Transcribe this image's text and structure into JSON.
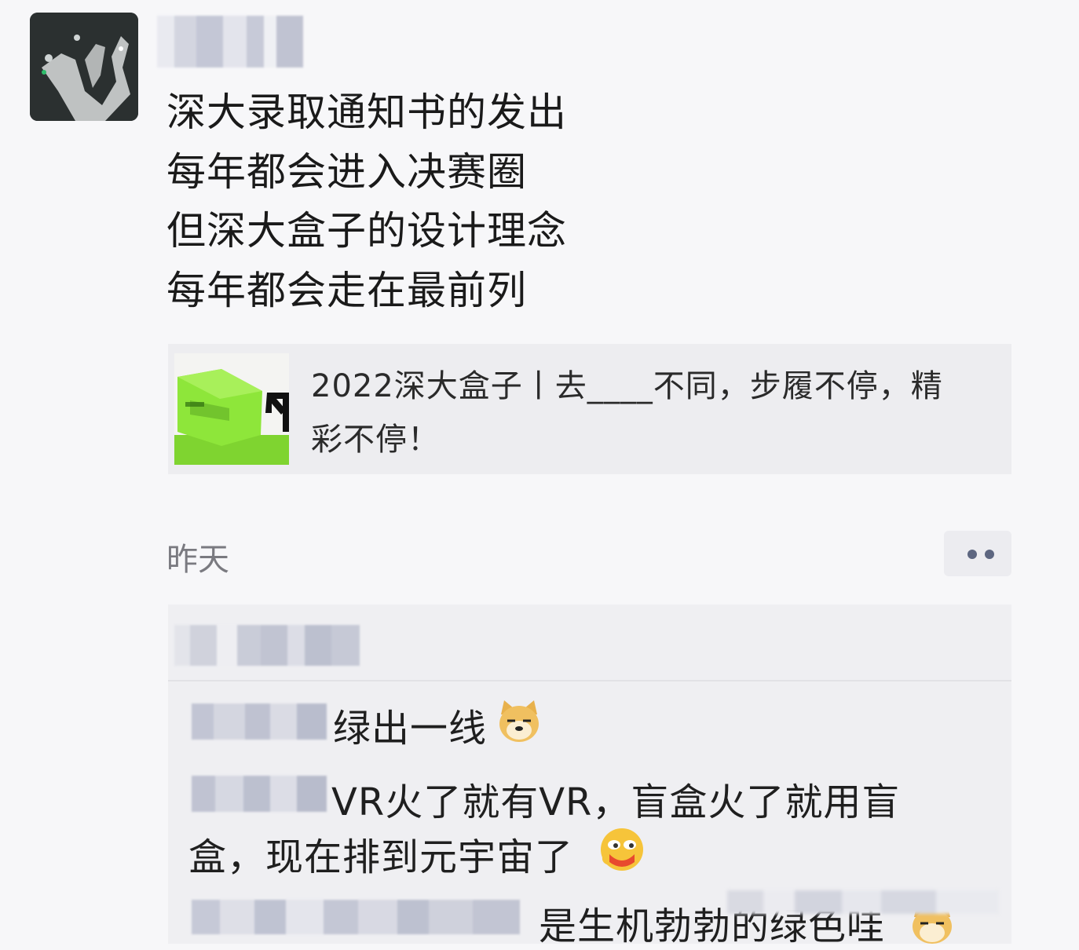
{
  "post": {
    "lines": [
      "深大录取通知书的发出",
      "每年都会进入决赛圈",
      "但深大盒子的设计理念",
      "每年都会走在最前列"
    ]
  },
  "link": {
    "title_line1": "2022深大盒子丨去____不同，步履不停，精",
    "title_line2": "彩不停！"
  },
  "time": "昨天",
  "comments": [
    {
      "text": "绿出一线",
      "emoji": "doge-emoji"
    },
    {
      "text_line1": "VR火了就有VR，盲盒火了就用盲",
      "text_line2": "盒，现在排到元宇宙了",
      "emoji": "smirk-emoji"
    },
    {
      "text": "是生机勃勃的绿色哇",
      "emoji": "doge-emoji"
    }
  ],
  "colors": {
    "background": "#f7f7f9",
    "card": "#ededf0",
    "time": "#7a7a80",
    "more_dots": "#5d6680"
  }
}
